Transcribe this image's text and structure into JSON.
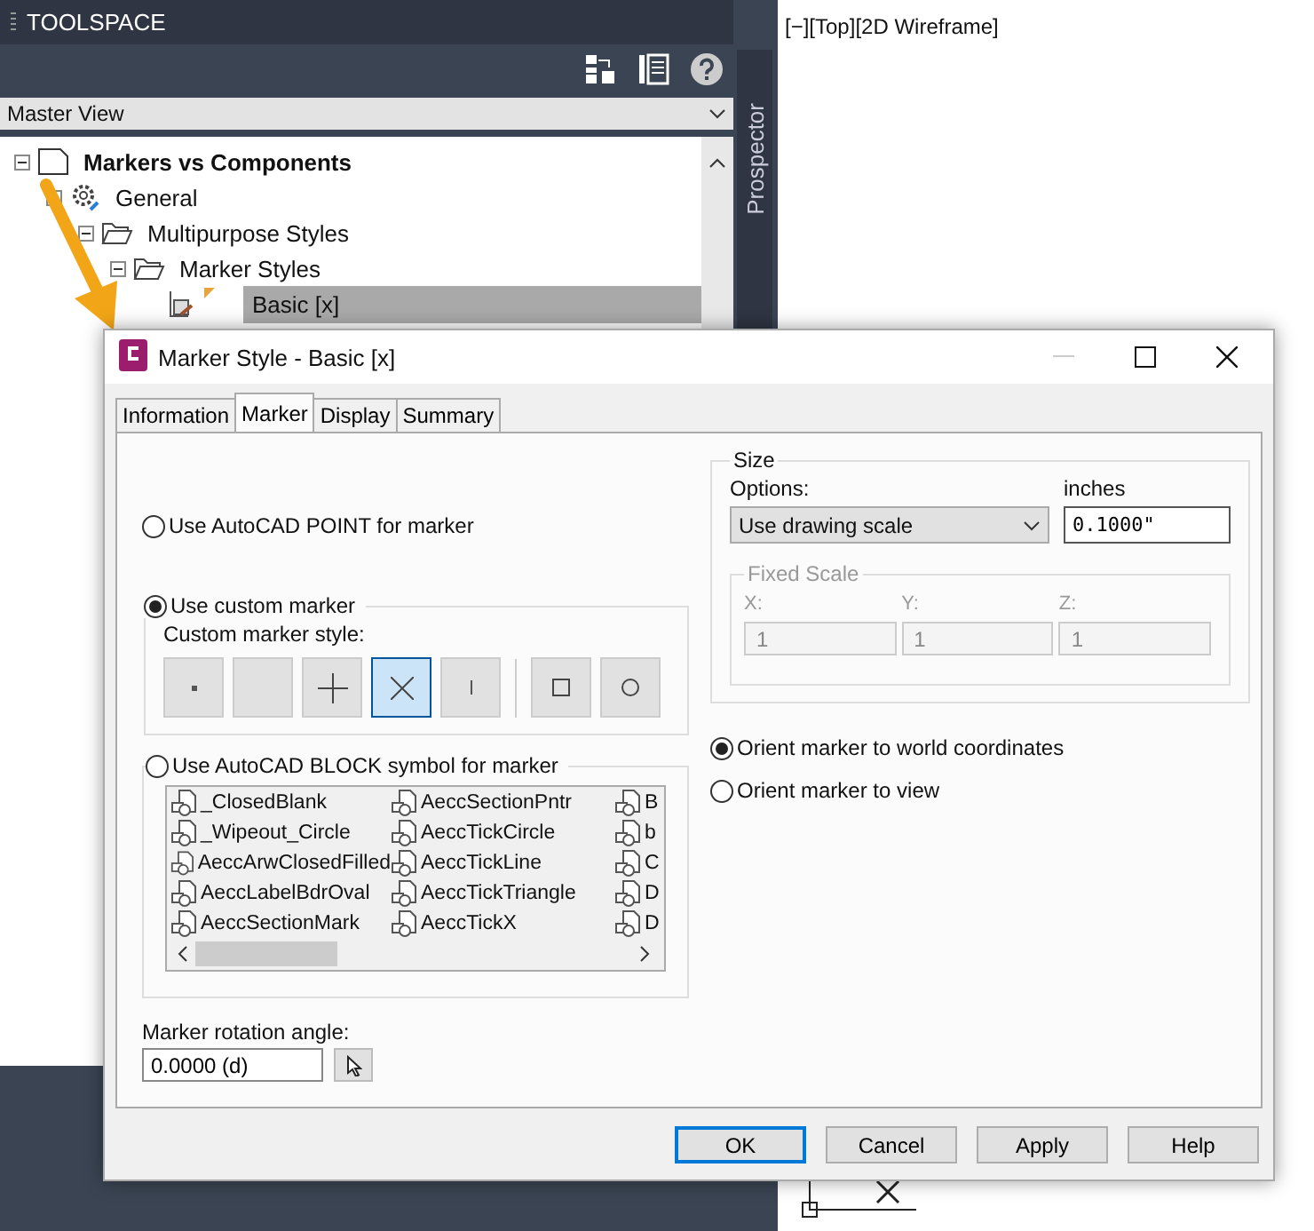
{
  "toolspace": {
    "title": "TOOLSPACE",
    "view": "Master View",
    "side_tab": "Prospector",
    "tree": [
      {
        "label": "Markers vs Components",
        "kind": "drawing",
        "expanded": true,
        "selected": false,
        "children": [
          {
            "label": "General",
            "kind": "settings",
            "expanded": true,
            "selected": false,
            "children": [
              {
                "label": "Multipurpose Styles",
                "kind": "folder",
                "expanded": true,
                "selected": false,
                "children": [
                  {
                    "label": "Marker Styles",
                    "kind": "folder",
                    "expanded": true,
                    "selected": false,
                    "children": [
                      {
                        "label": "Basic [x]",
                        "kind": "style",
                        "selected": true
                      }
                    ]
                  }
                ]
              }
            ]
          }
        ]
      }
    ]
  },
  "viewport": {
    "label": "[−][Top][2D Wireframe]"
  },
  "dialog": {
    "title": "Marker Style - Basic [x]",
    "tabs": [
      {
        "label": "Information",
        "selected": false
      },
      {
        "label": "Marker",
        "selected": true
      },
      {
        "label": "Display",
        "selected": false
      },
      {
        "label": "Summary",
        "selected": false
      }
    ],
    "point_radio": {
      "label": "Use AutoCAD POINT for marker",
      "selected": false
    },
    "custom_radio": {
      "label": "Use custom marker",
      "selected": true
    },
    "custom_style_label": "Custom marker style:",
    "marker_buttons": [
      {
        "kind": "dot",
        "selected": false
      },
      {
        "kind": "none",
        "selected": false
      },
      {
        "kind": "plus",
        "selected": false
      },
      {
        "kind": "cross",
        "selected": true
      },
      {
        "kind": "tick",
        "selected": false
      },
      {
        "kind": "separator"
      },
      {
        "kind": "square",
        "selected": false
      },
      {
        "kind": "circle",
        "selected": false
      }
    ],
    "block_radio": {
      "label": "Use AutoCAD BLOCK symbol for marker",
      "selected": false
    },
    "blocks": [
      "_ClosedBlank",
      "_Wipeout_Circle",
      "AeccArwClosedFilled",
      "AeccLabelBdrOval",
      "AeccSectionMark",
      "AeccSectionPntr",
      "AeccTickCircle",
      "AeccTickLine",
      "AeccTickTriangle",
      "AeccTickX",
      "B",
      "b",
      "C",
      "D",
      "D"
    ],
    "rotation": {
      "label": "Marker rotation angle:",
      "value": "0.0000 (d)"
    },
    "size": {
      "title": "Size",
      "options_label": "Options:",
      "option": "Use drawing scale",
      "units_label": "inches",
      "value": "0.1000\"",
      "fixed_scale": {
        "title": "Fixed Scale",
        "disabled": true,
        "fields": [
          {
            "label": "X:",
            "value": "1"
          },
          {
            "label": "Y:",
            "value": "1"
          },
          {
            "label": "Z:",
            "value": "1"
          }
        ]
      }
    },
    "orient": [
      {
        "label": "Orient marker to world coordinates",
        "selected": true
      },
      {
        "label": "Orient marker to view",
        "selected": false
      }
    ],
    "buttons": [
      {
        "label": "OK",
        "default": true
      },
      {
        "label": "Cancel",
        "default": false
      },
      {
        "label": "Apply",
        "default": false
      },
      {
        "label": "Help",
        "default": false
      }
    ]
  }
}
